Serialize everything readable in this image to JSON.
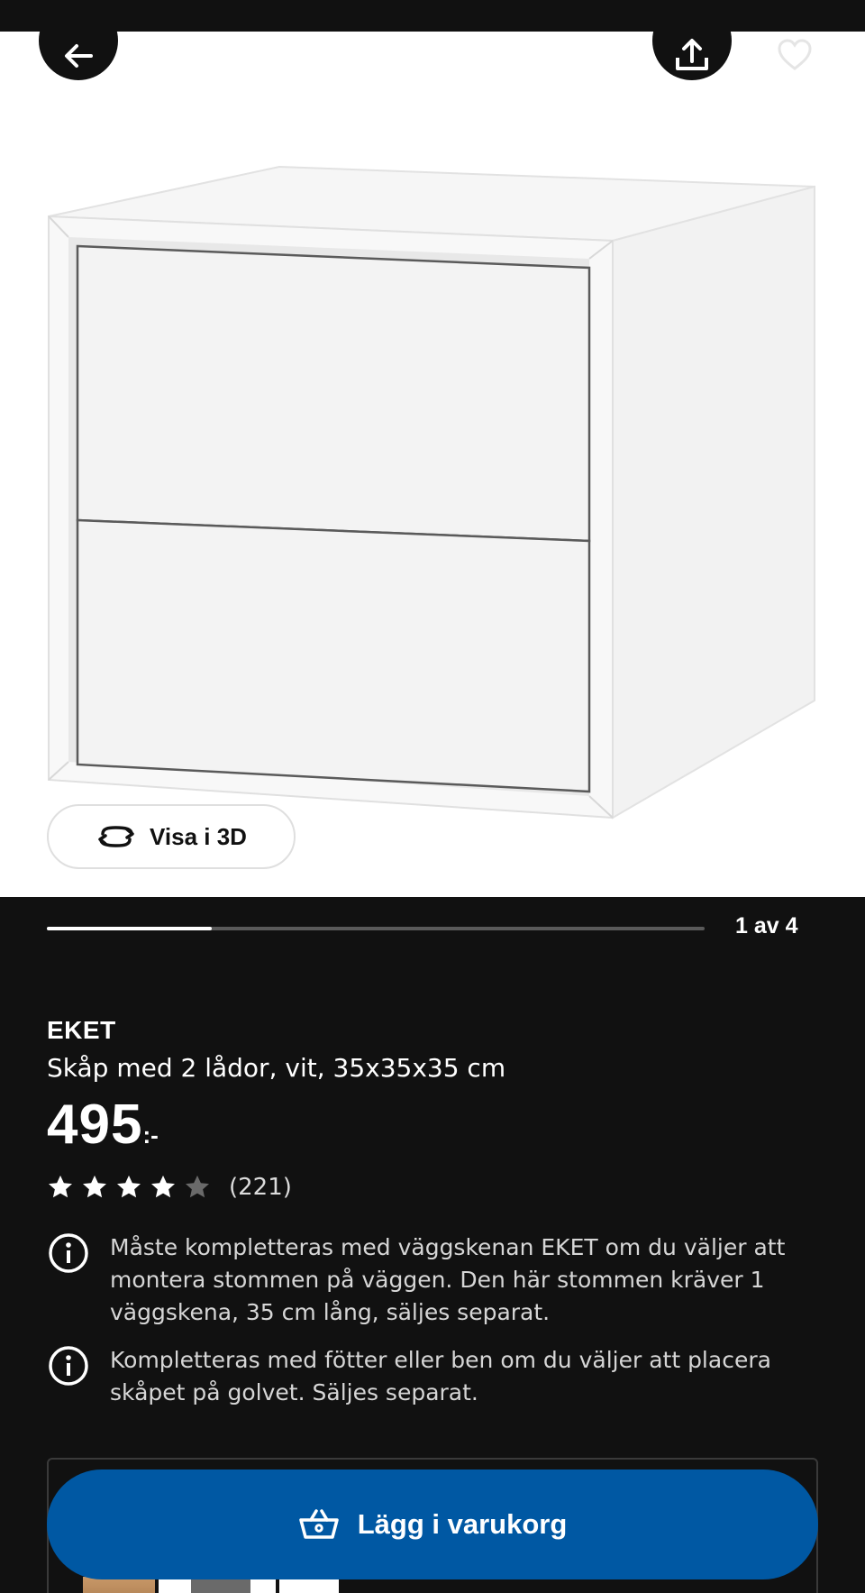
{
  "header": {
    "back_icon": "arrow-left-icon",
    "share_icon": "share-upload-icon",
    "favourite_icon": "heart-outline-icon"
  },
  "gallery": {
    "view_3d_label": "Visa i 3D",
    "view_3d_icon": "rotate-3d-icon",
    "position_label": "1 av 4",
    "progress_fraction": 0.25
  },
  "product": {
    "name": "EKET",
    "description": "Skåp med 2 lådor, vit, 35x35x35 cm",
    "price_integer": "495",
    "price_suffix": ":-",
    "rating_stars": 4,
    "rating_max": 5,
    "review_count": "(221)"
  },
  "notices": [
    {
      "icon": "info-icon",
      "text": "Måste kompletteras med väggskenan EKET om du väljer att montera stommen på väggen. Den här stommen kräver 1 väggskena, 35 cm lång, säljes separat."
    },
    {
      "icon": "info-icon",
      "text": "Kompletteras med fötter eller ben om du väljer att placera skåpet på golvet. Säljes separat."
    }
  ],
  "cart": {
    "add_label": "Lägg i varukorg",
    "icon": "shopping-basket-icon"
  },
  "colors": {
    "background": "#111111",
    "primary_blue": "#0058a3",
    "white": "#ffffff"
  }
}
